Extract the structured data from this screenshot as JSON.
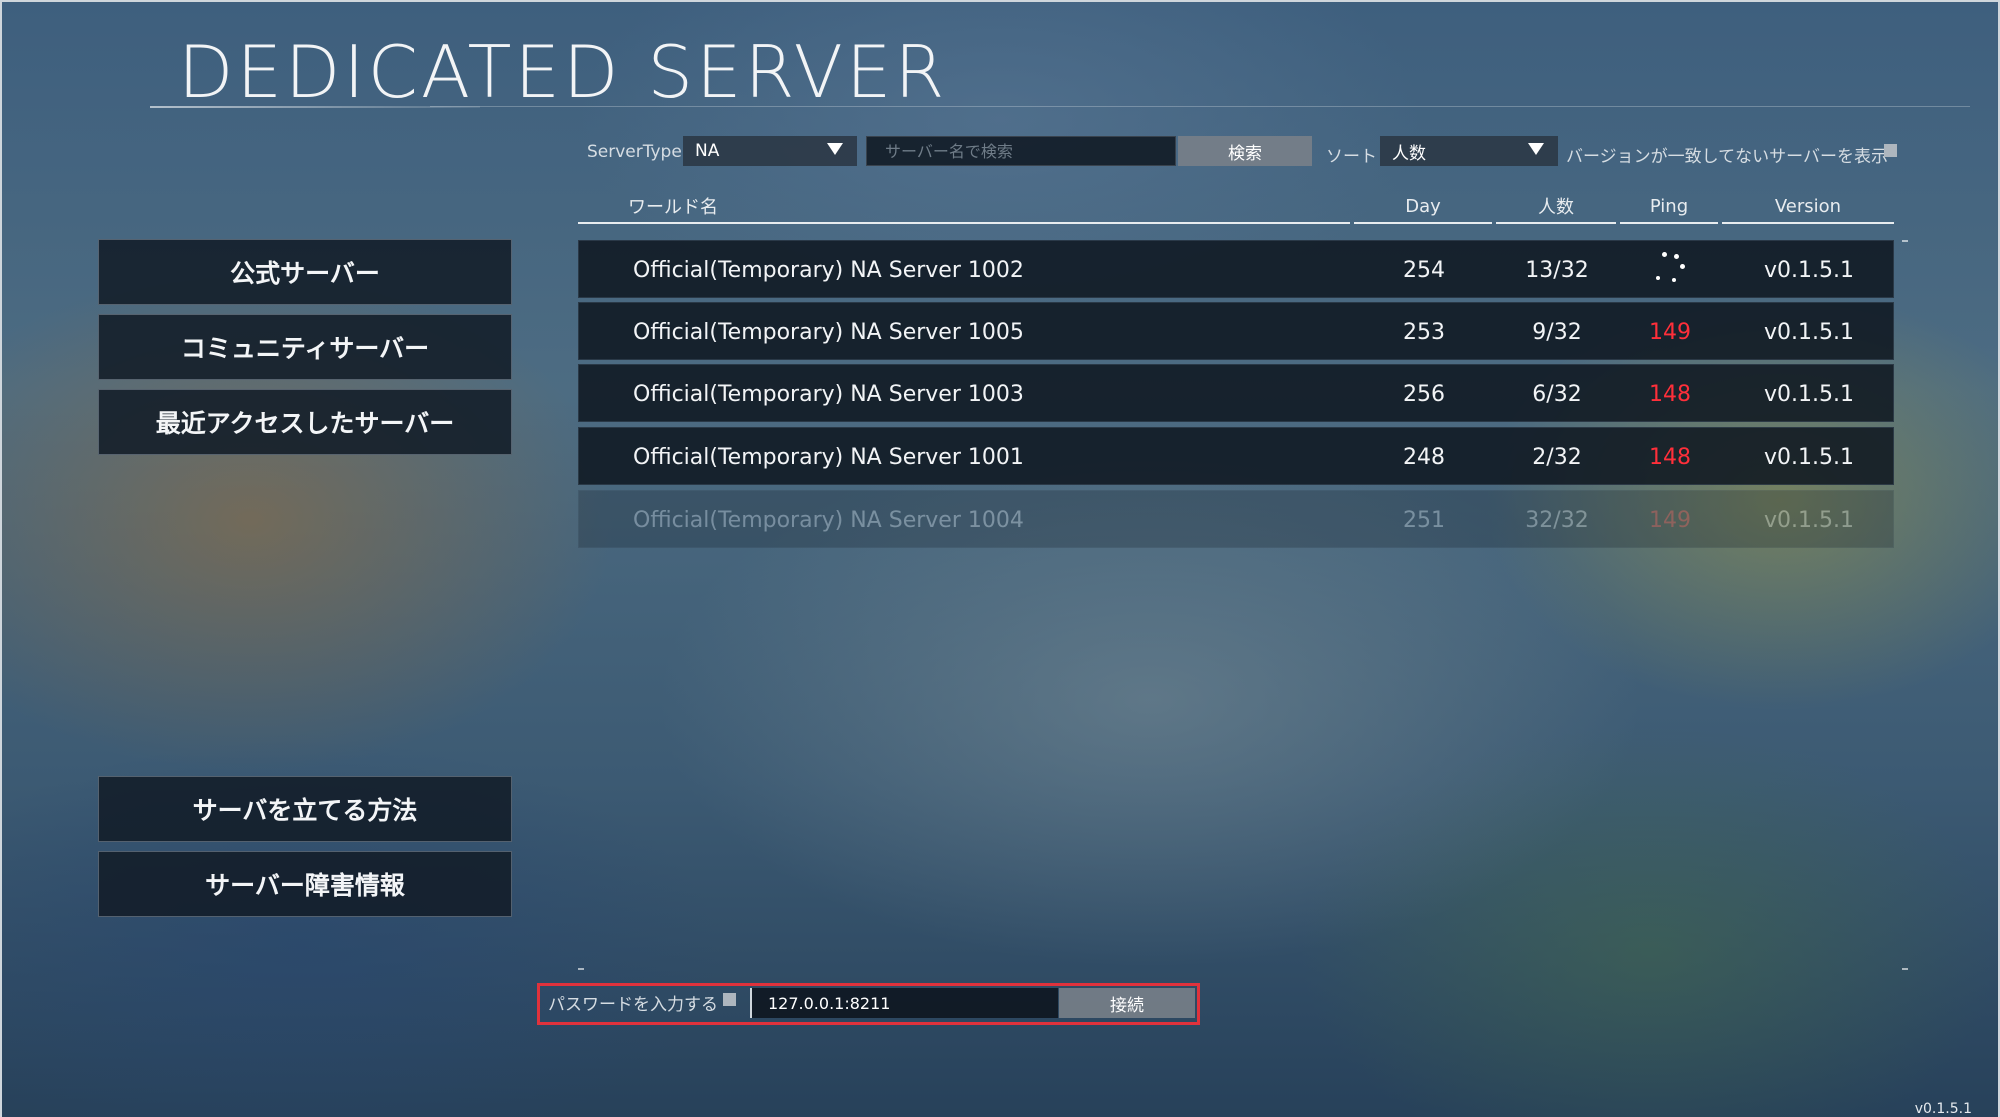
{
  "title": "DEDICATED SERVER",
  "sidebar": {
    "top_items": [
      {
        "label": "公式サーバー"
      },
      {
        "label": "コミュニティサーバー"
      },
      {
        "label": "最近アクセスしたサーバー"
      }
    ],
    "bottom_items": [
      {
        "label": "サーバを立てる方法"
      },
      {
        "label": "サーバー障害情報"
      }
    ]
  },
  "filters": {
    "server_type_label": "ServerType",
    "server_type_value": "NA",
    "search_placeholder": "サーバー名で検索",
    "search_button": "検索",
    "sort_label": "ソート",
    "sort_value": "人数",
    "show_mismatch_label": "バージョンが一致してないサーバーを表示"
  },
  "table": {
    "columns": [
      "ワールド名",
      "Day",
      "人数",
      "Ping",
      "Version"
    ],
    "rows": [
      {
        "name": "Official(Temporary) NA Server 1002",
        "day": "254",
        "players": "13/32",
        "ping": "",
        "version": "v0.1.5.1"
      },
      {
        "name": "Official(Temporary) NA Server 1005",
        "day": "253",
        "players": "9/32",
        "ping": "149",
        "version": "v0.1.5.1"
      },
      {
        "name": "Official(Temporary) NA Server 1003",
        "day": "256",
        "players": "6/32",
        "ping": "148",
        "version": "v0.1.5.1"
      },
      {
        "name": "Official(Temporary) NA Server 1001",
        "day": "248",
        "players": "2/32",
        "ping": "148",
        "version": "v0.1.5.1"
      },
      {
        "name": "Official(Temporary) NA Server 1004",
        "day": "251",
        "players": "32/32",
        "ping": "149",
        "version": "v0.1.5.1"
      }
    ]
  },
  "connect": {
    "password_label": "パスワードを入力する",
    "address_value": "127.0.0.1:8211",
    "connect_button": "接続"
  },
  "footer_version": "v0.1.5.1",
  "colors": {
    "ping_high": "#ff2f3a",
    "highlight_border": "#e0323c"
  }
}
